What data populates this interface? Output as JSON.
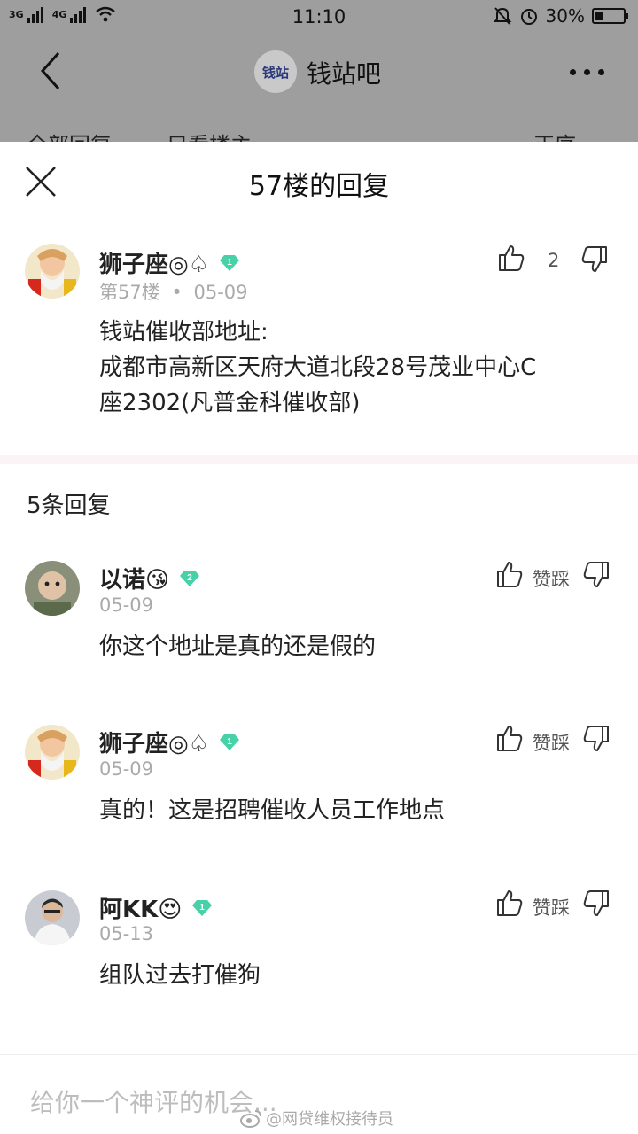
{
  "status_bar": {
    "network1": "3G",
    "network2": "4G",
    "time": "11:10",
    "battery": "30%",
    "battery_level": 0.3
  },
  "header": {
    "logo_text": "钱站",
    "bar_name": "钱站吧",
    "tabs": [
      "全部回复",
      "只看楼主",
      "正序"
    ]
  },
  "sheet": {
    "title": "57楼的回复",
    "main_post": {
      "user": "狮子座◎♤",
      "level": "1",
      "floor": "第57楼",
      "dot": "•",
      "date": "05-09",
      "likes": "2",
      "content_lines": [
        "钱站催收部地址:",
        " 成都市高新区天府大道北段28号茂业中心C",
        "座2302(凡普金科催收部)"
      ]
    },
    "reply_count": "5条回复",
    "replies": [
      {
        "user": "以诺😘",
        "level": "2",
        "date": "05-09",
        "text": "你这个地址是真的还是假的",
        "action": "赞踩"
      },
      {
        "user": "狮子座◎♤",
        "level": "1",
        "date": "05-09",
        "text": "真的！这是招聘催收人员工作地点",
        "action": "赞踩"
      },
      {
        "user": "阿KK😍",
        "level": "1",
        "date": "05-13",
        "text": "组队过去打催狗",
        "action": "赞踩"
      }
    ]
  },
  "input": {
    "placeholder": "给你一个神评的机会..."
  },
  "watermark": "@网贷维权接待员",
  "colors": {
    "dim_overlay": "#9e9e9e",
    "level_badge": "#48d1a8",
    "divider": "#fbf3f5"
  }
}
